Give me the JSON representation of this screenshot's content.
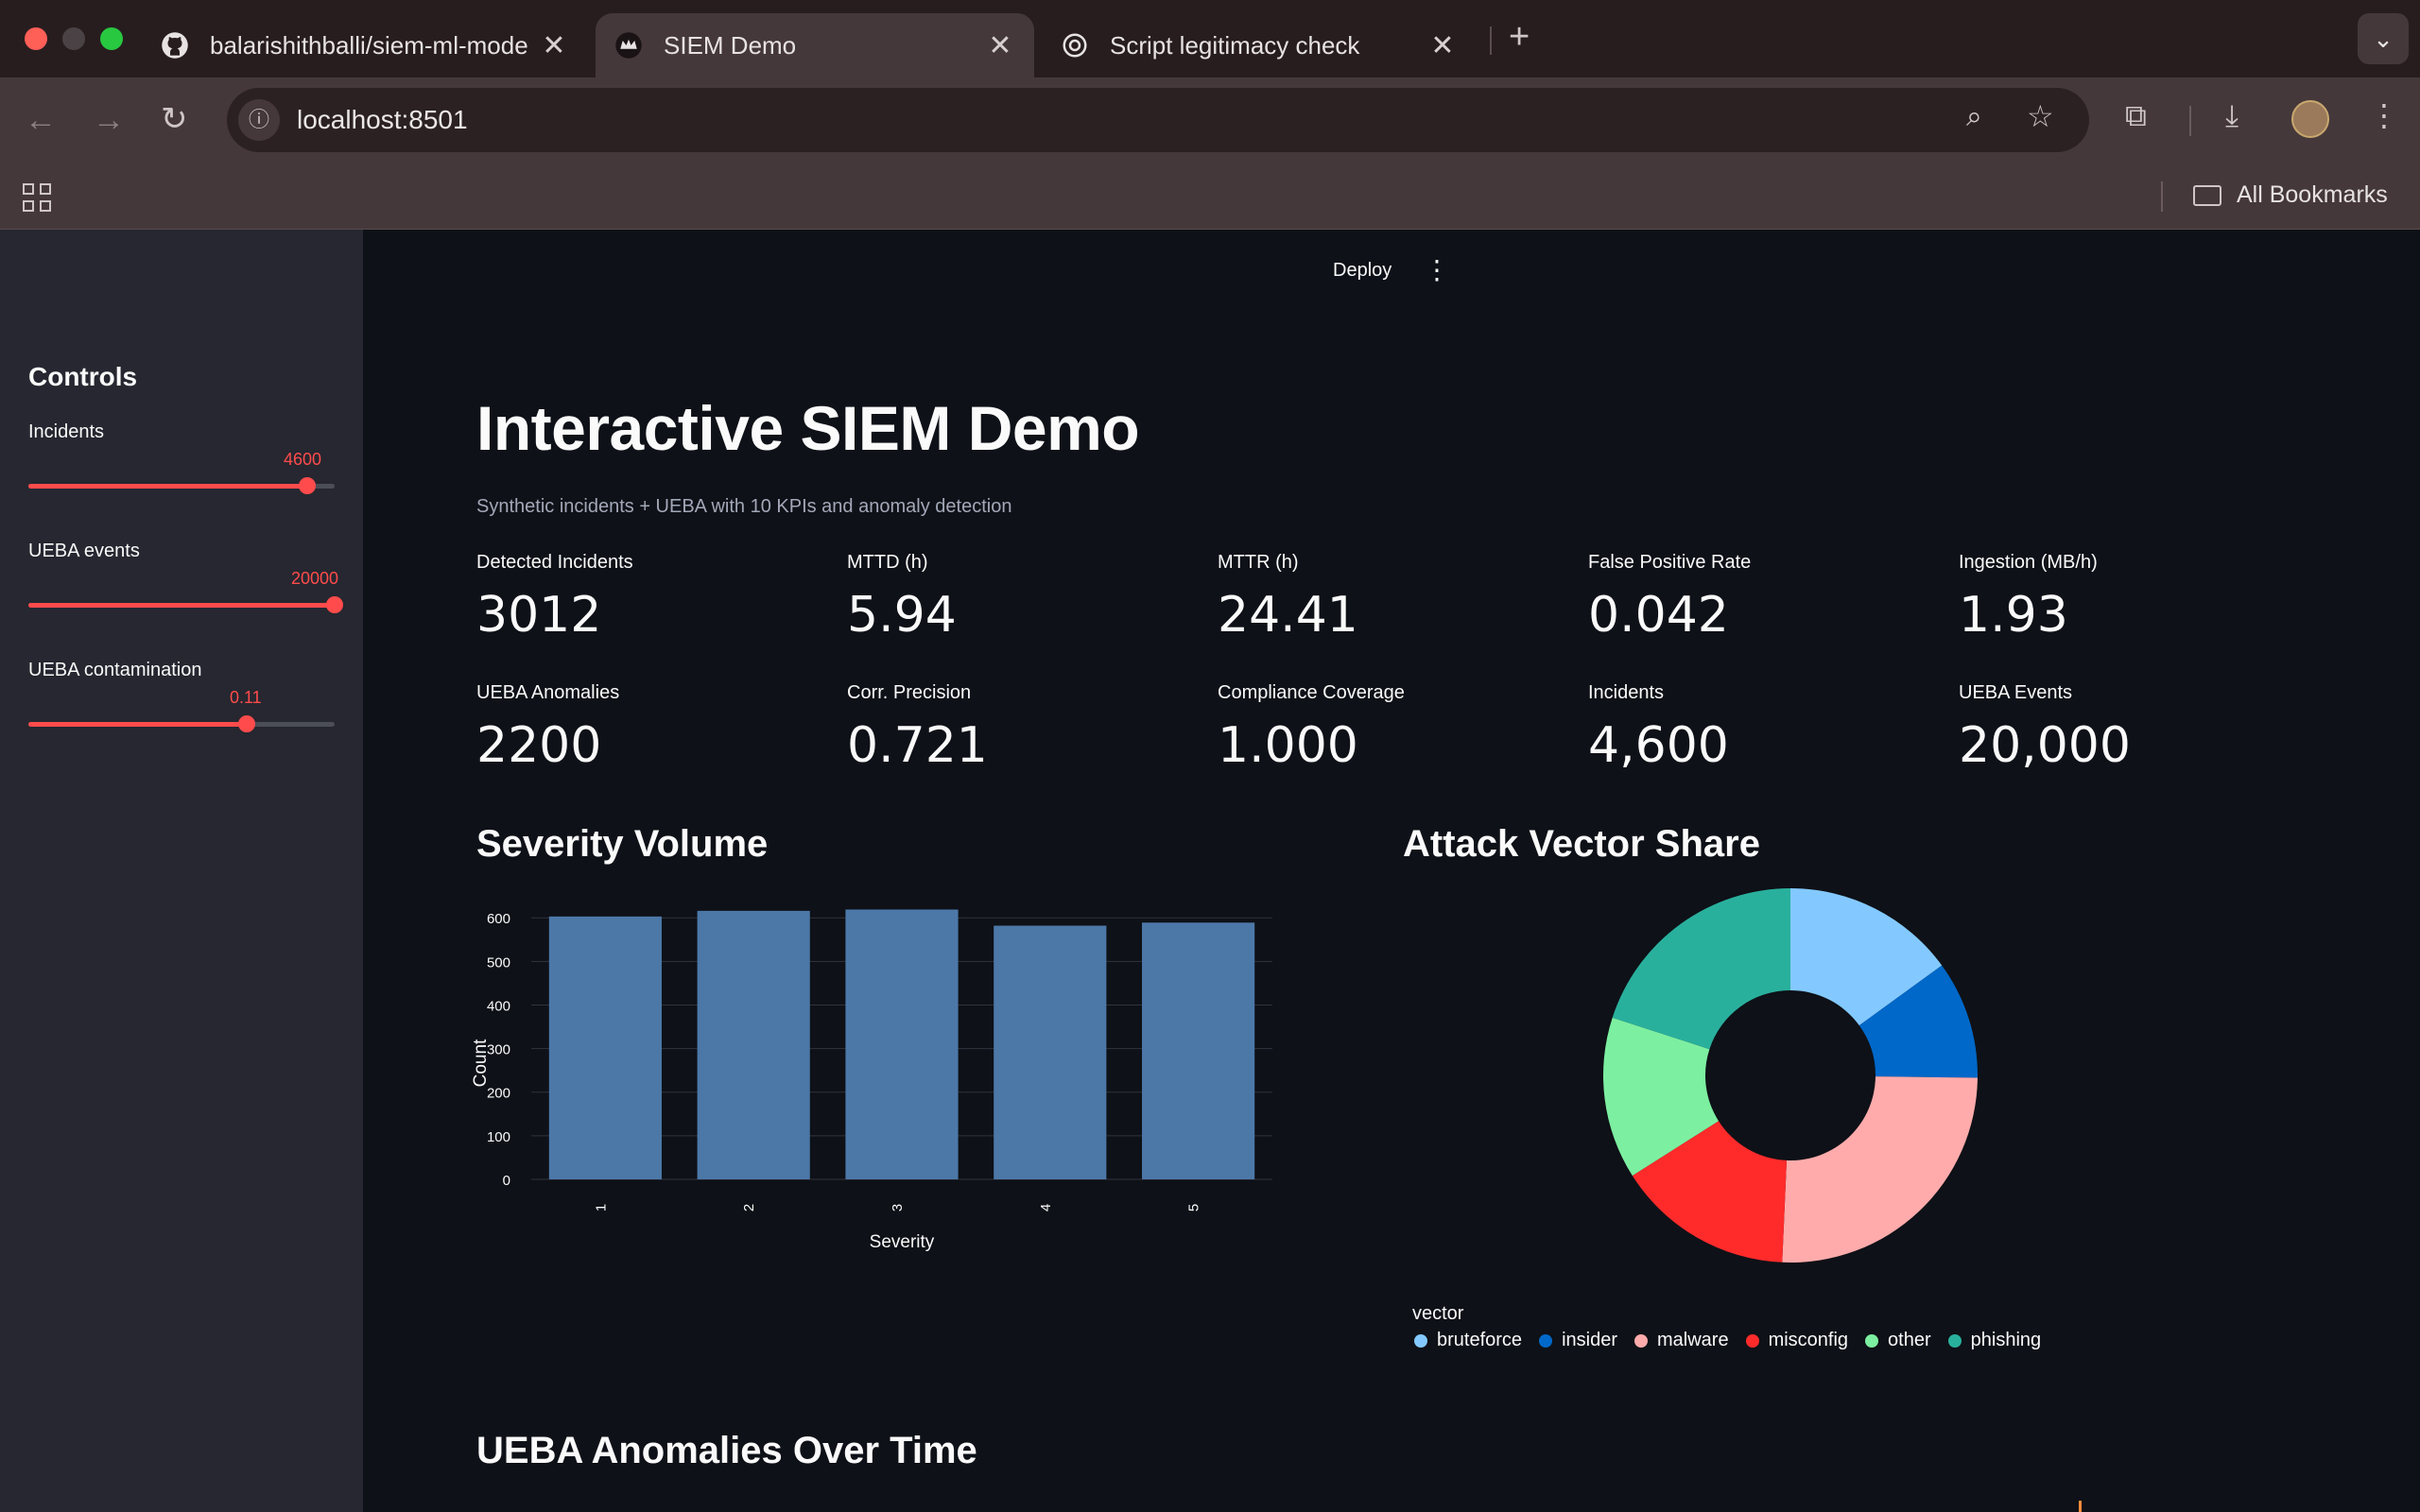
{
  "browser": {
    "tabs": [
      {
        "title": "balarishithballi/siem-ml-mode",
        "active": false
      },
      {
        "title": "SIEM Demo",
        "active": true
      },
      {
        "title": "Script legitimacy check",
        "active": false
      }
    ],
    "url": "localhost:8501",
    "bookmarks_label": "All Bookmarks"
  },
  "header": {
    "deploy_label": "Deploy"
  },
  "sidebar": {
    "title": "Controls",
    "sliders": [
      {
        "label": "Incidents",
        "value_text": "4600",
        "fraction": 0.91
      },
      {
        "label": "UEBA events",
        "value_text": "20000",
        "fraction": 1.0
      },
      {
        "label": "UEBA contamination",
        "value_text": "0.11",
        "fraction": 0.71
      }
    ]
  },
  "main": {
    "title": "Interactive SIEM Demo",
    "caption": "Synthetic incidents + UEBA with 10 KPIs and anomaly detection",
    "kpis": [
      {
        "label": "Detected Incidents",
        "value": "3012"
      },
      {
        "label": "MTTD (h)",
        "value": "5.94"
      },
      {
        "label": "MTTR (h)",
        "value": "24.41"
      },
      {
        "label": "False Positive Rate",
        "value": "0.042"
      },
      {
        "label": "Ingestion (MB/h)",
        "value": "1.93"
      },
      {
        "label": "UEBA Anomalies",
        "value": "2200"
      },
      {
        "label": "Corr. Precision",
        "value": "0.721"
      },
      {
        "label": "Compliance Coverage",
        "value": "1.000"
      },
      {
        "label": "Incidents",
        "value": "4,600"
      },
      {
        "label": "UEBA Events",
        "value": "20,000"
      }
    ],
    "severity_title": "Severity Volume",
    "vector_title": "Attack Vector Share",
    "ueba_title": "UEBA Anomalies Over Time"
  },
  "colors": {
    "accent": "#ff4b4b",
    "bar": "#4c78a8"
  },
  "chart_data": [
    {
      "type": "bar",
      "categories": [
        "1",
        "2",
        "3",
        "4",
        "5"
      ],
      "values": [
        603,
        616,
        619,
        582,
        589
      ],
      "xlabel": "Severity",
      "ylabel": "Count",
      "ylim": [
        0,
        620
      ],
      "yticks": [
        0,
        100,
        200,
        300,
        400,
        500,
        600
      ],
      "grid": true
    },
    {
      "type": "pie",
      "donut": true,
      "legend_title": "vector",
      "legend_position": "bottom",
      "slices": [
        {
          "name": "bruteforce",
          "value": 15.0,
          "color": "#83c9ff"
        },
        {
          "name": "insider",
          "value": 10.2,
          "color": "#0068c9"
        },
        {
          "name": "malware",
          "value": 25.5,
          "color": "#ffabab"
        },
        {
          "name": "misconfig",
          "value": 15.3,
          "color": "#ff2b2b"
        },
        {
          "name": "other",
          "value": 14.0,
          "color": "#7defa1"
        },
        {
          "name": "phishing",
          "value": 20.0,
          "color": "#29b09d"
        }
      ]
    }
  ]
}
